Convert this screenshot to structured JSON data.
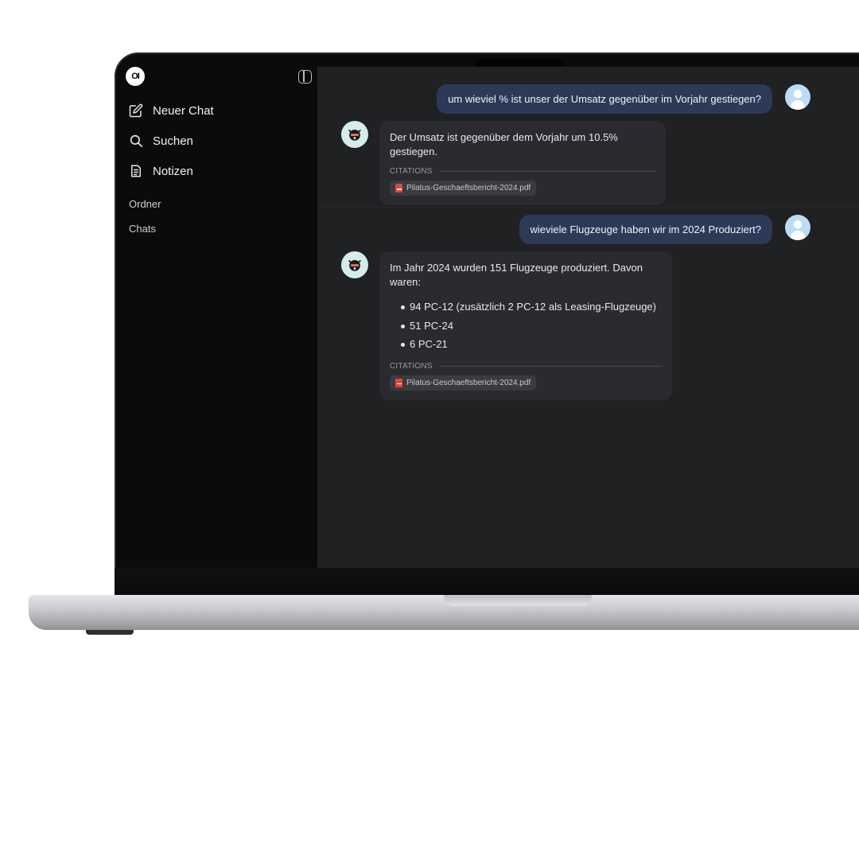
{
  "app": {
    "logo_text": "OI"
  },
  "sidebar": {
    "items": [
      {
        "label": "Neuer Chat",
        "icon": "edit-icon"
      },
      {
        "label": "Suchen",
        "icon": "search-icon"
      },
      {
        "label": "Notizen",
        "icon": "notes-icon"
      }
    ],
    "sections": [
      "Ordner",
      "Chats"
    ]
  },
  "chat": {
    "messages": [
      {
        "role": "user",
        "text": "um wieviel % ist unser der Umsatz gegenüber im Vorjahr gestiegen?"
      },
      {
        "role": "assistant",
        "text": "Der Umsatz ist gegenüber dem Vorjahr um 10.5% gestiegen.",
        "citations_label": "CITATIONS",
        "citation": "Pilatus-Geschaeftsbericht-2024.pdf"
      },
      {
        "role": "user",
        "text": "wieviele Flugzeuge haben wir im 2024 Produziert?"
      },
      {
        "role": "assistant",
        "text": "Im Jahr 2024 wurden 151 Flugzeuge produziert. Davon waren:",
        "bullets": [
          "94 PC-12 (zusätzlich 2 PC-12 als Leasing-Flugzeuge)",
          "51 PC-24",
          "6 PC-21"
        ],
        "citations_label": "CITATIONS",
        "citation": "Pilatus-Geschaeftsbericht-2024.pdf"
      }
    ]
  },
  "colors": {
    "user_bubble": "#2c3a58",
    "pdf_icon": "#e0463f",
    "bot_avatar_bg": "#d5ece8"
  }
}
